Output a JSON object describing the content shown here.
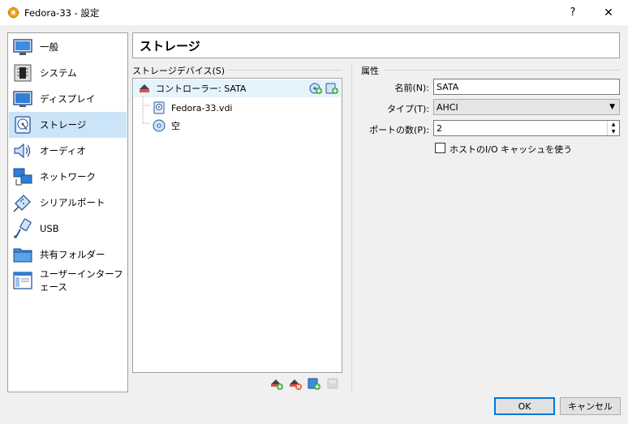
{
  "window": {
    "title": "Fedora-33 - 設定",
    "help": "?",
    "close": "✕"
  },
  "sidebar": {
    "items": [
      {
        "label": "一般",
        "icon": "general-icon"
      },
      {
        "label": "システム",
        "icon": "system-icon"
      },
      {
        "label": "ディスプレイ",
        "icon": "display-icon"
      },
      {
        "label": "ストレージ",
        "icon": "storage-icon",
        "selected": true
      },
      {
        "label": "オーディオ",
        "icon": "audio-icon"
      },
      {
        "label": "ネットワーク",
        "icon": "network-icon"
      },
      {
        "label": "シリアルポート",
        "icon": "serial-port-icon"
      },
      {
        "label": "USB",
        "icon": "usb-icon"
      },
      {
        "label": "共有フォルダー",
        "icon": "shared-folder-icon"
      },
      {
        "label": "ユーザーインターフェース",
        "icon": "user-interface-icon"
      }
    ]
  },
  "page": {
    "title": "ストレージ"
  },
  "storage": {
    "section_label": "ストレージデバイス(S)",
    "tree": [
      {
        "label": "コントローラー: SATA",
        "type": "controller"
      },
      {
        "label": "Fedora-33.vdi",
        "type": "hard-disk"
      },
      {
        "label": "空",
        "type": "optical"
      }
    ]
  },
  "attributes": {
    "section_label": "属性",
    "name_label": "名前(N):",
    "name_value": "SATA",
    "type_label": "タイプ(T):",
    "type_value": "AHCI",
    "ports_label": "ポートの数(P):",
    "ports_value": "2",
    "cache_label": "ホストのI/O キャッシュを使う",
    "cache_checked": false
  },
  "buttons": {
    "ok": "OK",
    "cancel": "キャンセル"
  },
  "colors": {
    "selection": "#cce4f7",
    "accent": "#0078d7"
  }
}
